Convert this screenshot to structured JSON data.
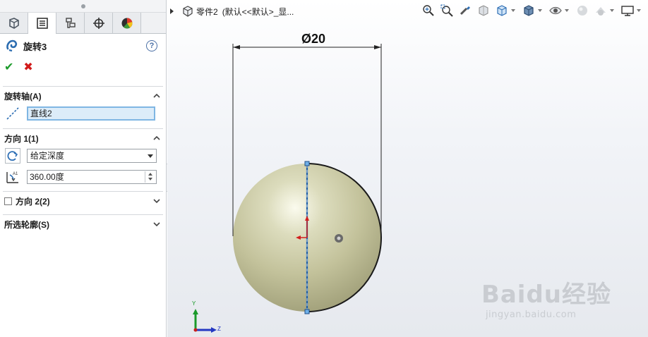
{
  "feature": {
    "title": "旋转3"
  },
  "groups": {
    "axis": {
      "label": "旋转轴(A)",
      "value": "直线2"
    },
    "direction1": {
      "label": "方向 1(1)",
      "type_selected": "给定深度",
      "angle": "360.00度"
    },
    "direction2": {
      "label": "方向 2(2)",
      "checked": false
    },
    "contours": {
      "label": "所选轮廓(S)"
    }
  },
  "breadcrumb": {
    "part": "零件2",
    "config": "(默认<<默认>_显..."
  },
  "dimension": {
    "text": "Ø20"
  },
  "triad": {
    "y": "Y",
    "z": "Z"
  },
  "watermark": {
    "brand": "Baidu经验",
    "url": "jingyan.baidu.com"
  },
  "colors": {
    "sphere": "#c9c8a2",
    "sketch_line": "#1f5fa8",
    "accent_blue": "#4a8fd0"
  },
  "icons": [
    "sketch-tab-icon",
    "property-manager-tab-icon",
    "config-manager-tab-icon",
    "dimxpert-tab-icon",
    "display-manager-tab-icon",
    "revolve-icon",
    "help-icon",
    "confirm-icon",
    "cancel-icon",
    "axis-line-icon",
    "reverse-direction-icon",
    "angle-icon",
    "zoom-to-fit-icon",
    "zoom-area-icon",
    "previous-view-icon",
    "section-view-icon",
    "view-orientation-icon",
    "display-style-icon",
    "hide-show-icon",
    "edit-appearance-icon",
    "apply-scene-icon",
    "view-settings-icon"
  ]
}
